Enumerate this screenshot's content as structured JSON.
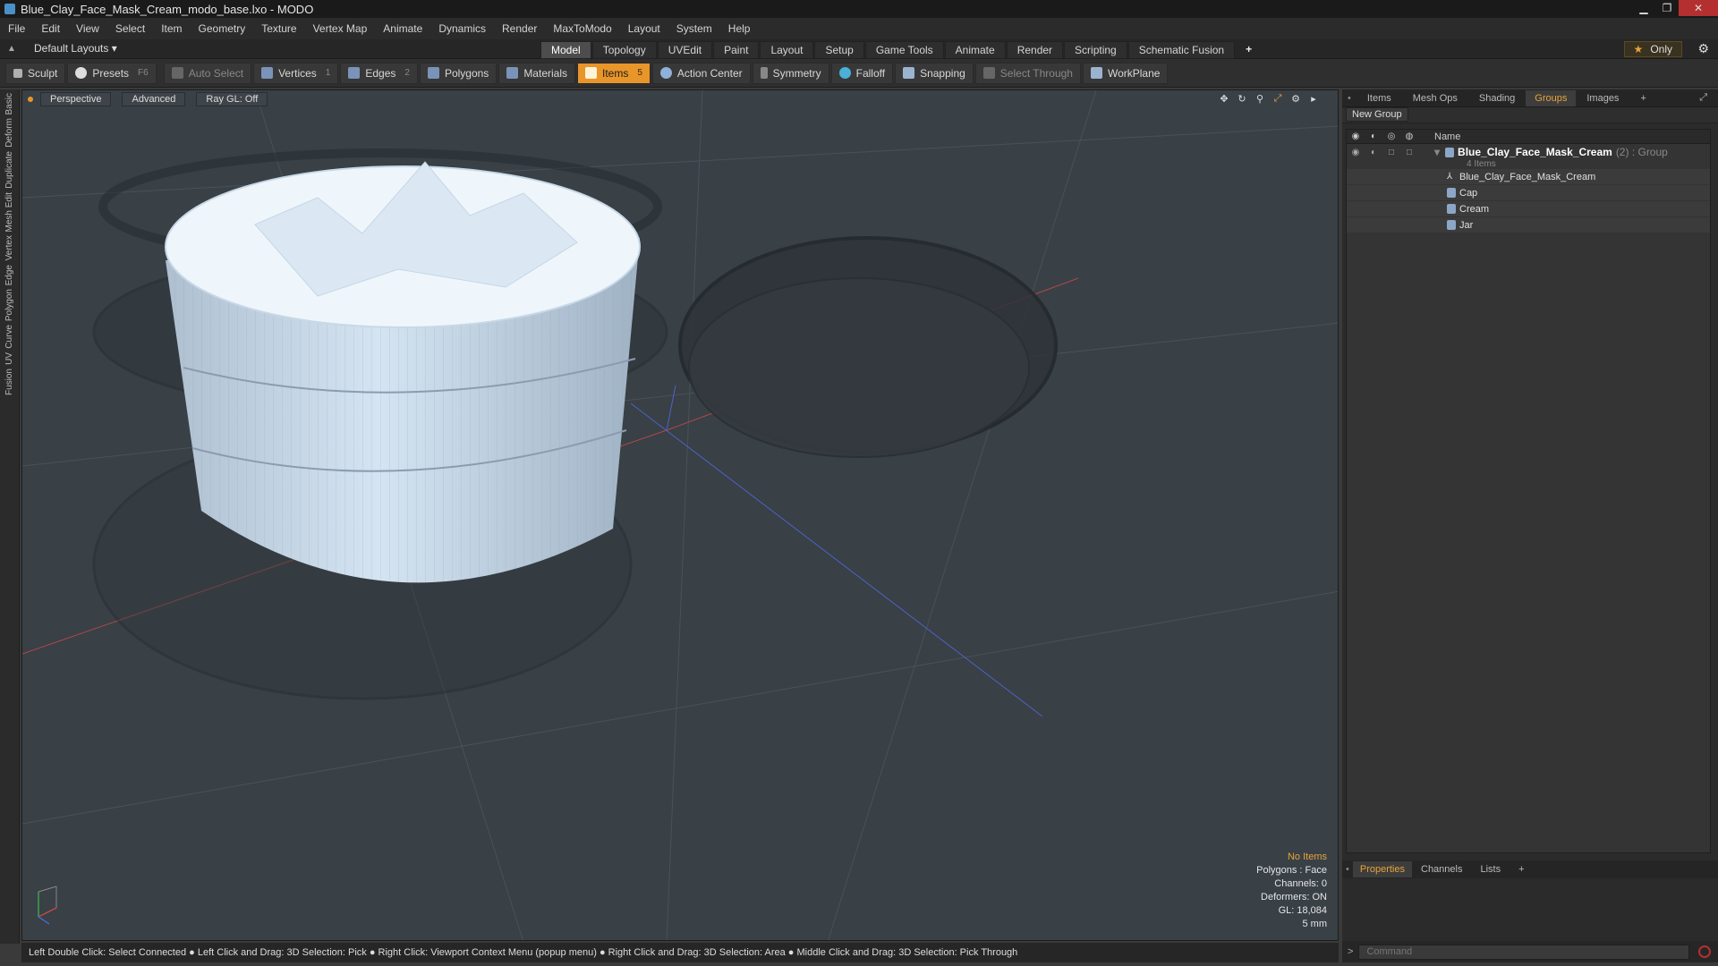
{
  "window": {
    "title": "Blue_Clay_Face_Mask_Cream_modo_base.lxo - MODO"
  },
  "menu": [
    "File",
    "Edit",
    "View",
    "Select",
    "Item",
    "Geometry",
    "Texture",
    "Vertex Map",
    "Animate",
    "Dynamics",
    "Render",
    "MaxToModo",
    "Layout",
    "System",
    "Help"
  ],
  "layoutbar": {
    "default_layouts": "Default Layouts ▾",
    "tabs": [
      "Model",
      "Topology",
      "UVEdit",
      "Paint",
      "Layout",
      "Setup",
      "Game Tools",
      "Animate",
      "Render",
      "Scripting",
      "Schematic Fusion"
    ],
    "active_tab": "Model",
    "only_label": "Only"
  },
  "toolbar": {
    "sculpt": "Sculpt",
    "presets": "Presets",
    "presets_key": "F6",
    "auto_select": "Auto Select",
    "vertices": "Vertices",
    "vertices_count": "1",
    "edges": "Edges",
    "edges_count": "2",
    "polygons": "Polygons",
    "materials": "Materials",
    "items": "Items",
    "items_count": "5",
    "action_center": "Action Center",
    "symmetry": "Symmetry",
    "falloff": "Falloff",
    "snapping": "Snapping",
    "select_through": "Select Through",
    "workplane": "WorkPlane"
  },
  "left_tabs": [
    "Basic",
    "Deform",
    "Duplicate",
    "Mesh Edit",
    "Vertex",
    "Edge",
    "Polygon",
    "Curve",
    "UV",
    "Fusion"
  ],
  "viewport": {
    "perspective": "Perspective",
    "advanced": "Advanced",
    "raygl": "Ray GL: Off",
    "info": {
      "no_items": "No Items",
      "polygons": "Polygons : Face",
      "channels": "Channels: 0",
      "deformers": "Deformers: ON",
      "gl": "GL: 18,084",
      "scale": "5 mm"
    }
  },
  "statusbar": "Left Double Click: Select Connected ● Left Click and Drag: 3D Selection: Pick ● Right Click: Viewport Context Menu (popup menu) ● Right Click and Drag: 3D Selection: Area ● Middle Click and Drag: 3D Selection: Pick Through",
  "right_panel": {
    "tabs": [
      "Items",
      "Mesh Ops",
      "Shading",
      "Groups",
      "Images"
    ],
    "active_tab": "Groups",
    "new_group": "New Group",
    "name_header": "Name",
    "group_name": "Blue_Clay_Face_Mask_Cream",
    "group_suffix": "(2) : Group",
    "group_count": "4 Items",
    "children": [
      "Blue_Clay_Face_Mask_Cream",
      "Cap",
      "Cream",
      "Jar"
    ],
    "bottom_tabs": [
      "Properties",
      "Channels",
      "Lists"
    ],
    "command_placeholder": "Command"
  },
  "colors": {
    "accent": "#e8952a",
    "viewport_bg": "#394046",
    "cream": "#dfeef8",
    "jar_fill": "#c9dced"
  }
}
